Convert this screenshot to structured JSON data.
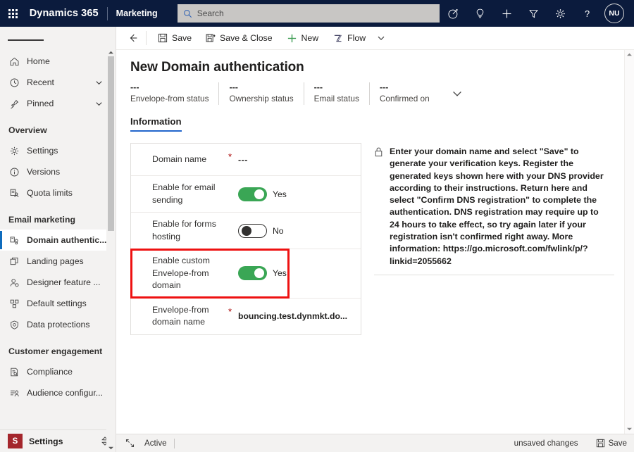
{
  "header": {
    "waffle_name": "app-launcher",
    "brand": "Dynamics 365",
    "app_name": "Marketing",
    "search_placeholder": "Search",
    "search_value": "",
    "icons": [
      {
        "name": "goals-icon",
        "title": "Goals"
      },
      {
        "name": "lightbulb-icon",
        "title": "Insights"
      },
      {
        "name": "quick-create-icon",
        "title": "Quick create"
      },
      {
        "name": "filter-icon",
        "title": "Filter"
      },
      {
        "name": "gear-icon",
        "title": "Settings"
      },
      {
        "name": "help-icon",
        "title": "Help"
      }
    ],
    "avatar_initials": "NU"
  },
  "sidebar": {
    "hamburger_name": "site-map-toggle",
    "items": [
      {
        "label": "Home",
        "icon": "home-icon",
        "chevron": false,
        "active": false
      },
      {
        "label": "Recent",
        "icon": "clock-icon",
        "chevron": true,
        "active": false
      },
      {
        "label": "Pinned",
        "icon": "pin-icon",
        "chevron": true,
        "active": false
      }
    ],
    "groups": [
      {
        "title": "Overview",
        "items": [
          {
            "label": "Settings",
            "icon": "gear-icon",
            "active": false
          },
          {
            "label": "Versions",
            "icon": "info-circle-icon",
            "active": false
          },
          {
            "label": "Quota limits",
            "icon": "quota-icon",
            "active": false
          }
        ]
      },
      {
        "title": "Email marketing",
        "items": [
          {
            "label": "Domain authentic...",
            "icon": "domain-auth-icon",
            "active": true
          },
          {
            "label": "Landing pages",
            "icon": "pages-icon",
            "active": false
          },
          {
            "label": "Designer feature ...",
            "icon": "designer-icon",
            "active": false
          },
          {
            "label": "Default settings",
            "icon": "default-settings-icon",
            "active": false
          },
          {
            "label": "Data protections",
            "icon": "shield-icon",
            "active": false
          }
        ]
      },
      {
        "title": "Customer engagement",
        "items": [
          {
            "label": "Compliance",
            "icon": "compliance-icon",
            "active": false
          },
          {
            "label": "Audience configur...",
            "icon": "audience-icon",
            "active": false
          }
        ]
      }
    ],
    "footer": {
      "tile": "S",
      "label": "Settings",
      "chevron_name": "app-switcher-icon"
    }
  },
  "commandbar": {
    "back_name": "back-button",
    "buttons": [
      {
        "label": "Save",
        "icon": "save-icon",
        "name": "save-button"
      },
      {
        "label": "Save & Close",
        "icon": "save-close-icon",
        "name": "save-and-close-button"
      },
      {
        "label": "New",
        "icon": "plus-icon",
        "name": "new-button"
      },
      {
        "label": "Flow",
        "icon": "flow-icon",
        "name": "flow-button"
      }
    ],
    "overflow_chevron": "chevron-down-icon"
  },
  "form": {
    "title": "New Domain authentication",
    "status_fields": [
      {
        "value": "---",
        "label": "Envelope-from status"
      },
      {
        "value": "---",
        "label": "Ownership status"
      },
      {
        "value": "---",
        "label": "Email status"
      },
      {
        "value": "---",
        "label": "Confirmed on"
      }
    ],
    "tabs": [
      {
        "label": "Information",
        "active": true
      }
    ],
    "fields": [
      {
        "label": "Domain name",
        "required": true,
        "type": "text",
        "value": "---",
        "highlighted": false
      },
      {
        "label": "Enable for email sending",
        "required": false,
        "type": "toggle",
        "toggle_on": true,
        "value": "Yes",
        "highlighted": false
      },
      {
        "label": "Enable for forms hosting",
        "required": false,
        "type": "toggle",
        "toggle_on": false,
        "value": "No",
        "highlighted": false
      },
      {
        "label": "Enable custom Envelope-from domain",
        "required": false,
        "type": "toggle",
        "toggle_on": true,
        "value": "Yes",
        "highlighted": true
      },
      {
        "label": "Envelope-from domain name",
        "required": true,
        "type": "text-bold",
        "value": "bouncing.test.dynmkt.do...",
        "highlighted": false
      }
    ],
    "info": {
      "icon": "lock-icon",
      "text": "Enter your domain name and select \"Save\" to generate your verification keys. Register the generated keys shown here with your DNS provider according to their instructions. Return here and select \"Confirm DNS registration\" to complete the authentication. DNS registration may require up to 24 hours to take effect, so try again later if your registration isn't confirmed right away. More information: https://go.microsoft.com/fwlink/p/?linkid=2055662"
    }
  },
  "footer": {
    "expand_icon": "expand-icon",
    "state": "Active",
    "unsaved": "unsaved changes",
    "save_label": "Save",
    "save_icon": "save-icon"
  },
  "colors": {
    "header_bg": "#0b1b3d",
    "accent_blue": "#0f6cbd",
    "toggle_green": "#3aa655",
    "highlight_red": "#ee1111",
    "required_red": "#a80000",
    "app_tile_red": "#a4262c"
  }
}
